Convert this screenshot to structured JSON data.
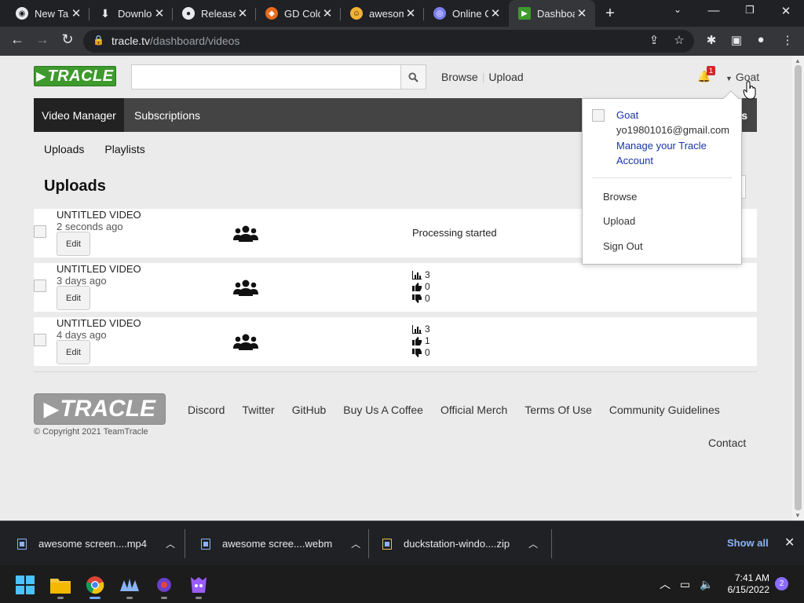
{
  "browser": {
    "tabs": [
      {
        "title": "New Tab",
        "favicon": "chrome-icon"
      },
      {
        "title": "Downloads",
        "favicon": "download-icon"
      },
      {
        "title": "Releases",
        "favicon": "github-icon"
      },
      {
        "title": "GD Colorizer",
        "favicon": "gd-icon"
      },
      {
        "title": "awesome",
        "favicon": "face-icon"
      },
      {
        "title": "Online Converter",
        "favicon": "converter-icon"
      },
      {
        "title": "Dashboard",
        "favicon": "tracle-icon",
        "active": true
      }
    ],
    "url_host": "tracle.tv",
    "url_path": "/dashboard/videos"
  },
  "header": {
    "logo": "TRACLE",
    "search_placeholder": "",
    "links": [
      "Browse",
      "Upload"
    ],
    "notification_count": "1",
    "user": "Goat"
  },
  "managerbar": {
    "tabs": [
      "Video Manager",
      "Subscriptions"
    ],
    "hidden_label": "s"
  },
  "subnav": [
    "Uploads",
    "Playlists"
  ],
  "uploads": {
    "heading": "Uploads",
    "edit_label": "Edit",
    "videos": [
      {
        "title": "UNTITLED VIDEO",
        "date": "2 seconds ago",
        "status": "Processing started"
      },
      {
        "title": "UNTITLED VIDEO",
        "date": "3 days ago",
        "views": "3",
        "likes": "0",
        "dislikes": "0"
      },
      {
        "title": "UNTITLED VIDEO",
        "date": "4 days ago",
        "views": "3",
        "likes": "1",
        "dislikes": "0"
      }
    ]
  },
  "dropdown": {
    "name": "Goat",
    "email": "yo19801016@gmail.com",
    "manage": "Manage your Tracle Account",
    "items": [
      "Browse",
      "Upload",
      "Sign Out"
    ]
  },
  "footer": {
    "logo": "TRACLE",
    "copyright": "© Copyright 2021 TeamTracle",
    "links": [
      "Discord",
      "Twitter",
      "GitHub",
      "Buy Us A Coffee",
      "Official Merch",
      "Terms Of Use",
      "Community Guidelines"
    ],
    "contact": "Contact"
  },
  "downloads": {
    "items": [
      "awesome screen....mp4",
      "awesome scree....webm",
      "duckstation-windo....zip"
    ],
    "show_all": "Show all"
  },
  "taskbar": {
    "time": "7:41 AM",
    "date": "6/15/2022",
    "notifications": "2"
  },
  "colors": {
    "logo_green": "#3e9a2d",
    "manager_bar": "#444444",
    "link_blue": "#1a33a8"
  }
}
